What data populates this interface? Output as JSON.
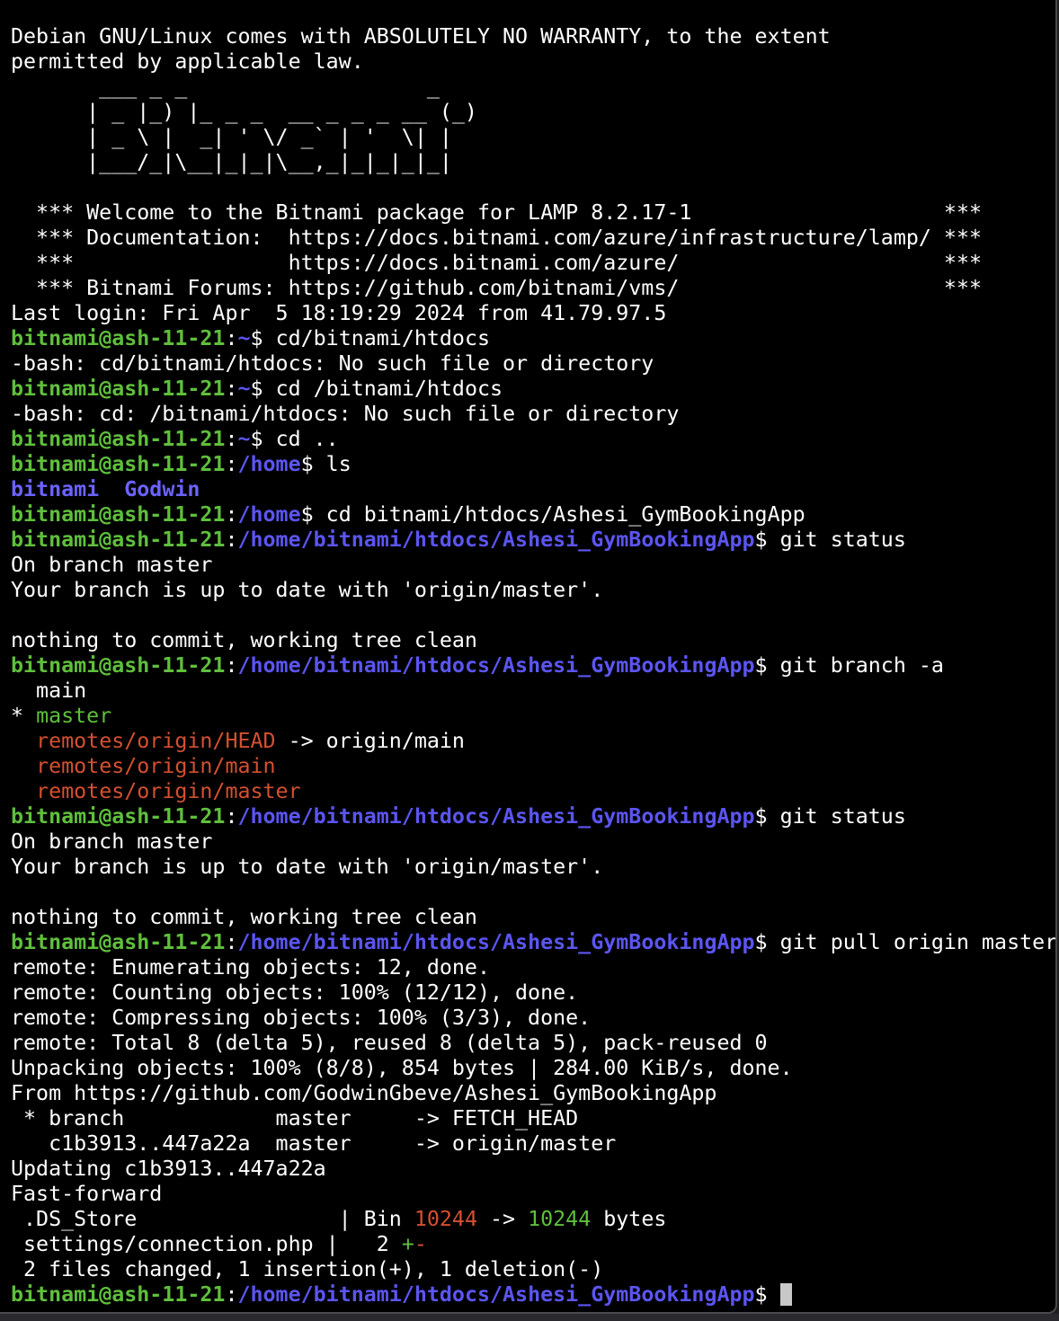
{
  "terminal": {
    "lines": [
      [
        {
          "t": "Debian GNU/Linux comes with ABSOLUTELY NO WARRANTY, to the extent"
        }
      ],
      [
        {
          "t": "permitted by applicable law."
        }
      ],
      [
        {
          "t": "       ___ _ _                   _"
        }
      ],
      [
        {
          "t": "      | _ |_) |_ _ _  __ _ _ _ __ (_)"
        }
      ],
      [
        {
          "t": "      | _ \\ |  _| ' \\/ _` | '  \\| |"
        }
      ],
      [
        {
          "t": "      |___/_|\\__|_|_|\\__,_|_|_|_|_|"
        }
      ],
      [
        {
          "t": ""
        }
      ],
      [
        {
          "t": "  *** Welcome to the Bitnami package for LAMP 8.2.17-1                    ***"
        }
      ],
      [
        {
          "t": "  *** Documentation:  https://docs.bitnami.com/azure/infrastructure/lamp/ ***"
        }
      ],
      [
        {
          "t": "  ***                 https://docs.bitnami.com/azure/                     ***"
        }
      ],
      [
        {
          "t": "  *** Bitnami Forums: https://github.com/bitnami/vms/                     ***"
        }
      ],
      [
        {
          "t": "Last login: Fri Apr  5 18:19:29 2024 from 41.79.97.5"
        }
      ],
      [
        {
          "t": "bitnami@ash-11-21",
          "c": "seg-green"
        },
        {
          "t": ":"
        },
        {
          "t": "~",
          "c": "seg-tilde"
        },
        {
          "t": "$ cd/bitnami/htdocs"
        }
      ],
      [
        {
          "t": "-bash: cd/bitnami/htdocs: No such file or directory"
        }
      ],
      [
        {
          "t": "bitnami@ash-11-21",
          "c": "seg-green"
        },
        {
          "t": ":"
        },
        {
          "t": "~",
          "c": "seg-tilde"
        },
        {
          "t": "$ cd /bitnami/htdocs"
        }
      ],
      [
        {
          "t": "-bash: cd: /bitnami/htdocs: No such file or directory"
        }
      ],
      [
        {
          "t": "bitnami@ash-11-21",
          "c": "seg-green"
        },
        {
          "t": ":"
        },
        {
          "t": "~",
          "c": "seg-tilde"
        },
        {
          "t": "$ cd .."
        }
      ],
      [
        {
          "t": "bitnami@ash-11-21",
          "c": "seg-green"
        },
        {
          "t": ":"
        },
        {
          "t": "/home",
          "c": "seg-blue"
        },
        {
          "t": "$ ls"
        }
      ],
      [
        {
          "t": "bitnami",
          "c": "seg-blue-plain"
        },
        {
          "t": "  "
        },
        {
          "t": "Godwin",
          "c": "seg-blue-plain"
        }
      ],
      [
        {
          "t": "bitnami@ash-11-21",
          "c": "seg-green"
        },
        {
          "t": ":"
        },
        {
          "t": "/home",
          "c": "seg-blue"
        },
        {
          "t": "$ cd bitnami/htdocs/Ashesi_GymBookingApp"
        }
      ],
      [
        {
          "t": "bitnami@ash-11-21",
          "c": "seg-green"
        },
        {
          "t": ":"
        },
        {
          "t": "/home/bitnami/htdocs/Ashesi_GymBookingApp",
          "c": "seg-blue"
        },
        {
          "t": "$ git status"
        }
      ],
      [
        {
          "t": "On branch master"
        }
      ],
      [
        {
          "t": "Your branch is up to date with 'origin/master'."
        }
      ],
      [
        {
          "t": ""
        }
      ],
      [
        {
          "t": "nothing to commit, working tree clean"
        }
      ],
      [
        {
          "t": "bitnami@ash-11-21",
          "c": "seg-green"
        },
        {
          "t": ":"
        },
        {
          "t": "/home/bitnami/htdocs/Ashesi_GymBookingApp",
          "c": "seg-blue"
        },
        {
          "t": "$ git branch -a"
        }
      ],
      [
        {
          "t": "  main"
        }
      ],
      [
        {
          "t": "* "
        },
        {
          "t": "master",
          "c": "seg-lgreen"
        }
      ],
      [
        {
          "t": "  "
        },
        {
          "t": "remotes/origin/HEAD",
          "c": "seg-red"
        },
        {
          "t": " -> origin/main"
        }
      ],
      [
        {
          "t": "  "
        },
        {
          "t": "remotes/origin/main",
          "c": "seg-red"
        }
      ],
      [
        {
          "t": "  "
        },
        {
          "t": "remotes/origin/master",
          "c": "seg-red"
        }
      ],
      [
        {
          "t": "bitnami@ash-11-21",
          "c": "seg-green"
        },
        {
          "t": ":"
        },
        {
          "t": "/home/bitnami/htdocs/Ashesi_GymBookingApp",
          "c": "seg-blue"
        },
        {
          "t": "$ git status"
        }
      ],
      [
        {
          "t": "On branch master"
        }
      ],
      [
        {
          "t": "Your branch is up to date with 'origin/master'."
        }
      ],
      [
        {
          "t": ""
        }
      ],
      [
        {
          "t": "nothing to commit, working tree clean"
        }
      ],
      [
        {
          "t": "bitnami@ash-11-21",
          "c": "seg-green"
        },
        {
          "t": ":"
        },
        {
          "t": "/home/bitnami/htdocs/Ashesi_GymBookingApp",
          "c": "seg-blue"
        },
        {
          "t": "$ git pull origin master"
        }
      ],
      [
        {
          "t": "remote: Enumerating objects: 12, done."
        }
      ],
      [
        {
          "t": "remote: Counting objects: 100% (12/12), done."
        }
      ],
      [
        {
          "t": "remote: Compressing objects: 100% (3/3), done."
        }
      ],
      [
        {
          "t": "remote: Total 8 (delta 5), reused 8 (delta 5), pack-reused 0"
        }
      ],
      [
        {
          "t": "Unpacking objects: 100% (8/8), 854 bytes | 284.00 KiB/s, done."
        }
      ],
      [
        {
          "t": "From https://github.com/GodwinGbeve/Ashesi_GymBookingApp"
        }
      ],
      [
        {
          "t": " * branch            master     -> FETCH_HEAD"
        }
      ],
      [
        {
          "t": "   c1b3913..447a22a  master     -> origin/master"
        }
      ],
      [
        {
          "t": "Updating c1b3913..447a22a"
        }
      ],
      [
        {
          "t": "Fast-forward"
        }
      ],
      [
        {
          "t": " .DS_Store                | Bin "
        },
        {
          "t": "10244",
          "c": "seg-red"
        },
        {
          "t": " -> "
        },
        {
          "t": "10244",
          "c": "seg-lgreen"
        },
        {
          "t": " bytes"
        }
      ],
      [
        {
          "t": " settings/connection.php |   2 "
        },
        {
          "t": "+",
          "c": "seg-lgreen"
        },
        {
          "t": "-",
          "c": "seg-red"
        }
      ],
      [
        {
          "t": " 2 files changed, 1 insertion(+), 1 deletion(-)"
        }
      ],
      [
        {
          "t": "bitnami@ash-11-21",
          "c": "seg-green"
        },
        {
          "t": ":"
        },
        {
          "t": "/home/bitnami/htdocs/Ashesi_GymBookingApp",
          "c": "seg-blue"
        },
        {
          "t": "$ "
        },
        {
          "cursor": true
        }
      ]
    ]
  },
  "colors": {
    "background": "#000000",
    "text": "#ffffff",
    "prompt_user": "#5fbf3c",
    "prompt_path": "#5b55f0",
    "remote_branch": "#d45030",
    "cursor": "#c8c8c8"
  }
}
